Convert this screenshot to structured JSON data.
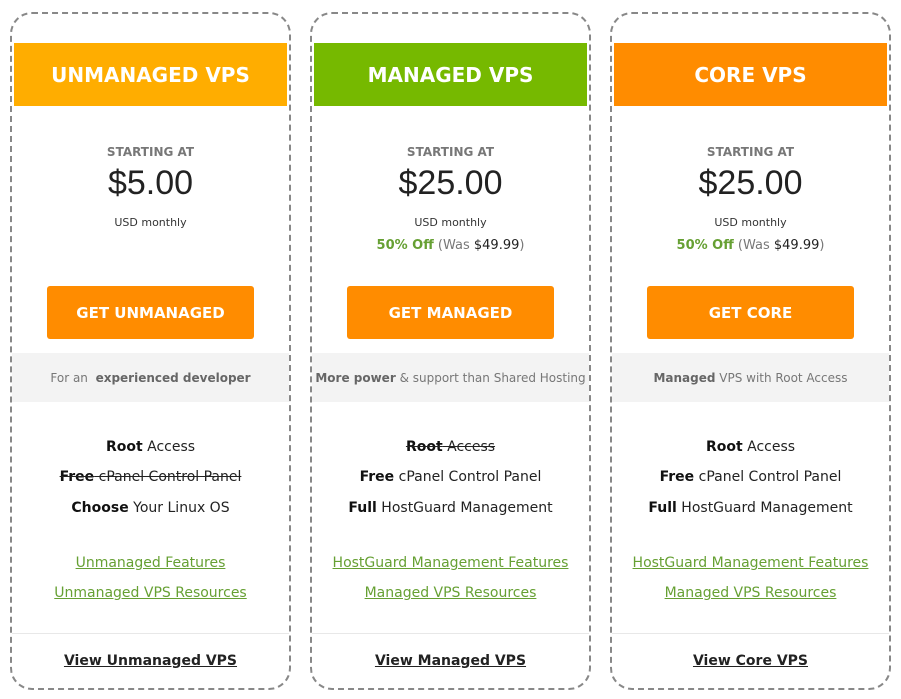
{
  "colors": {
    "unmanaged_header": "#ffad00",
    "managed_header": "#76b900",
    "core_header": "#ff8c00",
    "button": "#ff8c00",
    "link_green": "#66a033",
    "band_bg": "#f3f3f3"
  },
  "plans": [
    {
      "title": "UNMANAGED VPS",
      "starting_label": "STARTING AT",
      "price": "$5.00",
      "period": "USD monthly",
      "discount": null,
      "button_label": "GET UNMANAGED",
      "tagline": {
        "pre": "For an ",
        "bold": "experienced developer",
        "post": ""
      },
      "features": [
        {
          "bold": "Root",
          "text": " Access",
          "struck": false
        },
        {
          "bold": "Free",
          "text": " cPanel Control Panel",
          "struck": true
        },
        {
          "bold": "Choose",
          "text": " Your Linux OS",
          "struck": false
        }
      ],
      "links": [
        "Unmanaged Features",
        "Unmanaged VPS Resources"
      ],
      "footer_link": "View Unmanaged VPS"
    },
    {
      "title": "MANAGED VPS",
      "starting_label": "STARTING AT",
      "price": "$25.00",
      "period": "USD monthly",
      "discount": {
        "off": "50% Off",
        "was_pre": " (Was ",
        "was_price": "$49.99",
        "was_post": ")"
      },
      "button_label": "GET MANAGED",
      "tagline": {
        "pre": "",
        "bold": "More power",
        "post": " & support than Shared Hosting"
      },
      "features": [
        {
          "bold": "Root",
          "text": " Access",
          "struck": true
        },
        {
          "bold": "Free",
          "text": " cPanel Control Panel",
          "struck": false
        },
        {
          "bold": "Full",
          "text": " HostGuard Management",
          "struck": false
        }
      ],
      "links": [
        "HostGuard Management Features",
        "Managed VPS Resources"
      ],
      "footer_link": "View Managed VPS"
    },
    {
      "title": "CORE VPS",
      "starting_label": "STARTING AT",
      "price": "$25.00",
      "period": "USD monthly",
      "discount": {
        "off": "50% Off",
        "was_pre": " (Was ",
        "was_price": "$49.99",
        "was_post": ")"
      },
      "button_label": "GET CORE",
      "tagline": {
        "pre": "",
        "bold": "Managed",
        "post": " VPS with Root Access"
      },
      "features": [
        {
          "bold": "Root",
          "text": " Access",
          "struck": false
        },
        {
          "bold": "Free",
          "text": " cPanel Control Panel",
          "struck": false
        },
        {
          "bold": "Full",
          "text": " HostGuard Management",
          "struck": false
        }
      ],
      "links": [
        "HostGuard Management Features",
        "Managed VPS Resources"
      ],
      "footer_link": "View Core VPS"
    }
  ]
}
